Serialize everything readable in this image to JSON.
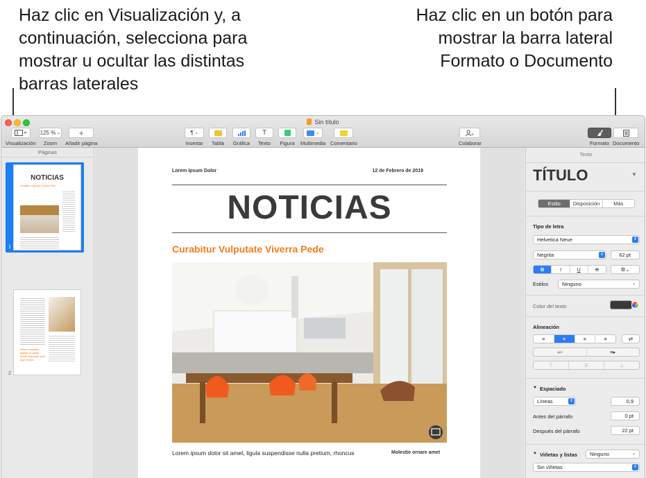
{
  "callouts": {
    "left": "Haz clic en Visualización y, a continuación, selecciona para mostrar u ocultar las distintas barras laterales",
    "right": "Haz clic en un botón para mostrar la barra lateral Formato o Documento"
  },
  "window": {
    "title": "Sin título"
  },
  "toolbar": {
    "view": "Visualización",
    "zoom_value": "125 %",
    "zoom": "Zoom",
    "add_page": "Añadir página",
    "insert": "Insertar",
    "table": "Tabla",
    "chart": "Gráfica",
    "text": "Texto",
    "shape": "Figura",
    "media": "Multimedia",
    "comment": "Comentario",
    "collaborate": "Colaborar",
    "format": "Formato",
    "document": "Documento"
  },
  "sidebar": {
    "header": "Páginas",
    "pages": [
      {
        "number": "1",
        "title": "NOTICIAS",
        "subtitle": "Curabitur Vulputate Viverra Pede"
      },
      {
        "number": "2",
        "pull_quote": "Etiam vulputate sapien et quam. Morbi vulputate velit eget lectus."
      }
    ]
  },
  "page": {
    "header_left": "Lorem Ipsum Dolor",
    "header_right": "12 de Febrero de 2019",
    "title": "NOTICIAS",
    "subtitle": "Curabitur Vulputate Viverra Pede",
    "body": "Lorem ipsum dolor sit amet, ligula suspendisse nulla pretium, rhoncus",
    "sidebar_caption": "Molestie ornare amet"
  },
  "inspector": {
    "header": "Texto",
    "style_name": "TÍTULO",
    "tabs": [
      "Estilo",
      "Disposición",
      "Más"
    ],
    "font_label": "Tipo de letra",
    "font_family": "Helvetica Neue",
    "font_weight": "Negrita",
    "font_size": "62 pt",
    "format_buttons": [
      "B",
      "I",
      "U",
      "S"
    ],
    "styles_label": "Estilos",
    "styles_value": "Ninguno",
    "text_color_label": "Color del texto",
    "text_color": "#3a3a3a",
    "alignment_label": "Alineación",
    "spacing_label": "Espaciado",
    "spacing_mode": "Líneas",
    "spacing_value": "0,9",
    "before_label": "Antes del párrafo",
    "before_value": "0 pt",
    "after_label": "Después del párrafo",
    "after_value": "22 pt",
    "bullets_label": "Viñetas y listas",
    "bullets_value": "Ninguno",
    "bullets_type": "Sin viñetas"
  },
  "colors": {
    "accent": "#2b7cf6",
    "orange": "#f07c1a",
    "title_gray": "#3a3a3a"
  }
}
